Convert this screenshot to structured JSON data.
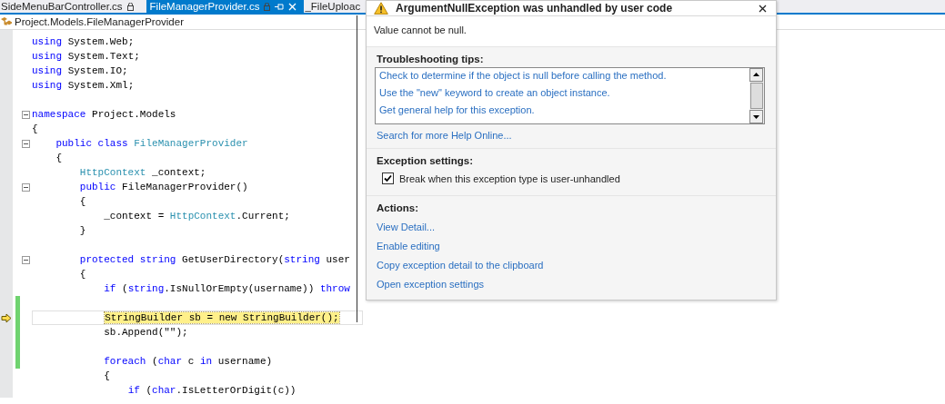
{
  "tabs": [
    {
      "label": "SideMenuBarController.cs",
      "selected": false,
      "locked": true
    },
    {
      "label": "FileManagerProvider.cs",
      "selected": true,
      "locked": true
    },
    {
      "label": "_FileUploac",
      "selected": false,
      "locked": false
    }
  ],
  "breadcrumb": "Project.Models.FileManagerProvider",
  "code_lines": [
    {
      "tokens": [
        {
          "kind": "kw",
          "text": "using"
        },
        {
          "kind": "plain",
          "text": " System.Web;"
        }
      ]
    },
    {
      "tokens": [
        {
          "kind": "kw",
          "text": "using"
        },
        {
          "kind": "plain",
          "text": " System.Text;"
        }
      ]
    },
    {
      "tokens": [
        {
          "kind": "kw",
          "text": "using"
        },
        {
          "kind": "plain",
          "text": " System.IO;"
        }
      ]
    },
    {
      "tokens": [
        {
          "kind": "kw",
          "text": "using"
        },
        {
          "kind": "plain",
          "text": " System.Xml;"
        }
      ]
    },
    {
      "changed": false
    },
    {
      "collapsible": true,
      "tokens": [
        {
          "kind": "kw",
          "text": "namespace"
        },
        {
          "kind": "plain",
          "text": " Project.Models"
        }
      ]
    },
    {
      "tokens": [
        {
          "kind": "plain",
          "text": "{"
        }
      ]
    },
    {
      "collapsible": true,
      "tokens": [
        {
          "kind": "kw",
          "text": "    public class"
        },
        {
          "kind": "type",
          "text": " FileManagerProvider"
        }
      ]
    },
    {
      "tokens": [
        {
          "kind": "plain",
          "text": "    {"
        }
      ]
    },
    {
      "tokens": [
        {
          "kind": "type",
          "text": "        HttpContext"
        },
        {
          "kind": "plain",
          "text": " _context;"
        }
      ]
    },
    {
      "collapsible": true,
      "tokens": [
        {
          "kind": "kw",
          "text": "        public"
        },
        {
          "kind": "plain",
          "text": " FileManagerProvider()"
        }
      ]
    },
    {
      "tokens": [
        {
          "kind": "plain",
          "text": "        {"
        }
      ]
    },
    {
      "tokens": [
        {
          "kind": "plain",
          "text": "            _context = "
        },
        {
          "kind": "type",
          "text": "HttpContext"
        },
        {
          "kind": "plain",
          "text": ".Current;"
        }
      ]
    },
    {
      "tokens": [
        {
          "kind": "plain",
          "text": "        }"
        }
      ]
    },
    {
      "changed": false
    },
    {
      "collapsible": true,
      "tokens": [
        {
          "kind": "kw",
          "text": "        protected string"
        },
        {
          "kind": "plain",
          "text": " GetUserDirectory("
        },
        {
          "kind": "kw",
          "text": "string"
        },
        {
          "kind": "plain",
          "text": " user"
        }
      ]
    },
    {
      "tokens": [
        {
          "kind": "plain",
          "text": "        {"
        }
      ]
    },
    {
      "tokens": [
        {
          "kind": "kw",
          "text": "            if"
        },
        {
          "kind": "plain",
          "text": " ("
        },
        {
          "kind": "kw",
          "text": "string"
        },
        {
          "kind": "plain",
          "text": ".IsNullOrEmpty(username)) "
        },
        {
          "kind": "kw",
          "text": "throw"
        }
      ]
    },
    {
      "changed": true
    },
    {
      "changed": true,
      "current": true,
      "tokens": [
        {
          "kind": "hl",
          "text": "            StringBuilder sb = new StringBuilder();"
        }
      ]
    },
    {
      "changed": true,
      "tokens": [
        {
          "kind": "plain",
          "text": "            sb.Append(\"\");"
        }
      ]
    },
    {
      "changed": true
    },
    {
      "changed": true,
      "tokens": [
        {
          "kind": "kw",
          "text": "            foreach"
        },
        {
          "kind": "plain",
          "text": " ("
        },
        {
          "kind": "kw",
          "text": "char"
        },
        {
          "kind": "plain",
          "text": " c "
        },
        {
          "kind": "kw",
          "text": "in"
        },
        {
          "kind": "plain",
          "text": " username)"
        }
      ]
    },
    {
      "tokens": [
        {
          "kind": "plain",
          "text": "            {"
        }
      ]
    },
    {
      "tokens": [
        {
          "kind": "kw",
          "text": "                if"
        },
        {
          "kind": "plain",
          "text": " ("
        },
        {
          "kind": "kw",
          "text": "char"
        },
        {
          "kind": "plain",
          "text": ".IsLetterOrDigit(c))"
        }
      ]
    }
  ],
  "exception_popup": {
    "title": "ArgumentNullException was unhandled by user code",
    "message": "Value cannot be null.",
    "tips_heading": "Troubleshooting tips:",
    "tips": [
      "Check to determine if the object is null before calling the method.",
      "Use the \"new\" keyword to create an object instance.",
      "Get general help for this exception."
    ],
    "search_link": "Search for more Help Online...",
    "settings_heading": "Exception settings:",
    "break_option": {
      "label": "Break when this exception type is user-unhandled",
      "checked": true
    },
    "actions_heading": "Actions:",
    "actions": [
      "View Detail...",
      "Enable editing",
      "Copy exception detail to the clipboard",
      "Open exception settings"
    ]
  }
}
